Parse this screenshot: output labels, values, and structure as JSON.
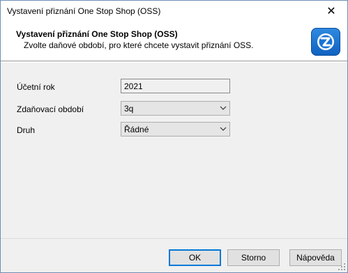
{
  "window": {
    "title": "Vystavení přiznání One Stop Shop (OSS)",
    "close_glyph": "✕"
  },
  "header": {
    "title": "Vystavení přiznání One Stop Shop (OSS)",
    "subtitle": "Zvolte daňové období, pro které chcete vystavit přiznání OSS.",
    "logo_icon": "app-logo-icon"
  },
  "form": {
    "fields": [
      {
        "label": "Účetní rok",
        "value": "2021",
        "type": "readonly"
      },
      {
        "label": "Zdaňovací období",
        "value": "3q",
        "type": "select"
      },
      {
        "label": "Druh",
        "value": "Řádné",
        "type": "select"
      }
    ]
  },
  "buttons": {
    "ok": "OK",
    "cancel": "Storno",
    "help": "Nápověda"
  },
  "colors": {
    "accent": "#0078d7",
    "logo": "#1a73d4",
    "dialog_bg": "#f0f0f0"
  }
}
